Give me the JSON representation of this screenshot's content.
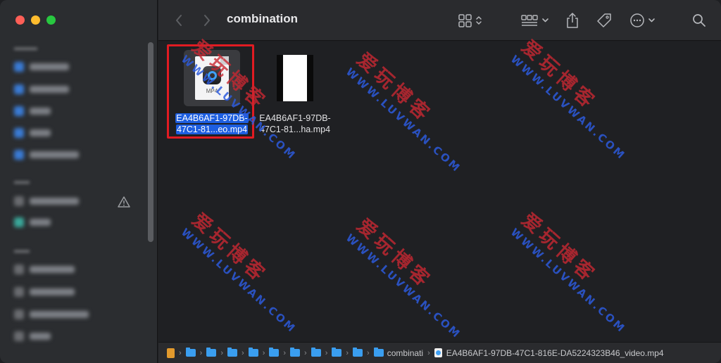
{
  "window": {
    "title": "combination"
  },
  "toolbar": {
    "back_icon": "chevron-left-icon",
    "forward_icon": "chevron-right-icon",
    "view_icon": "grid-view-icon",
    "group_icon": "group-by-icon",
    "share_icon": "share-icon",
    "tag_icon": "tag-icon",
    "more_icon": "ellipsis-circle-icon",
    "search_icon": "search-icon"
  },
  "files": [
    {
      "name_line1": "EA4B6AF1-97DB-",
      "name_line2": "47C1-81...eo.mp4",
      "icon_label": "MP4",
      "selected": true
    },
    {
      "name_line1": "EA4B6AF1-97DB-",
      "name_line2": "47C1-81...ha.mp4",
      "selected": false
    }
  ],
  "pathbar": {
    "current_folder": "combinati",
    "current_file": "EA4B6AF1-97DB-47C1-816E-DA5224323B46_video.mp4"
  },
  "watermark": {
    "cn": "爱玩博客",
    "en": "WWW.LUVWAN.COM"
  },
  "colors": {
    "selection_blue": "#1d5ee0",
    "highlight_red": "#e11b22",
    "folder_blue": "#3a9ef0",
    "watermark_red": "#c82832",
    "watermark_blue": "#2d5adc"
  }
}
